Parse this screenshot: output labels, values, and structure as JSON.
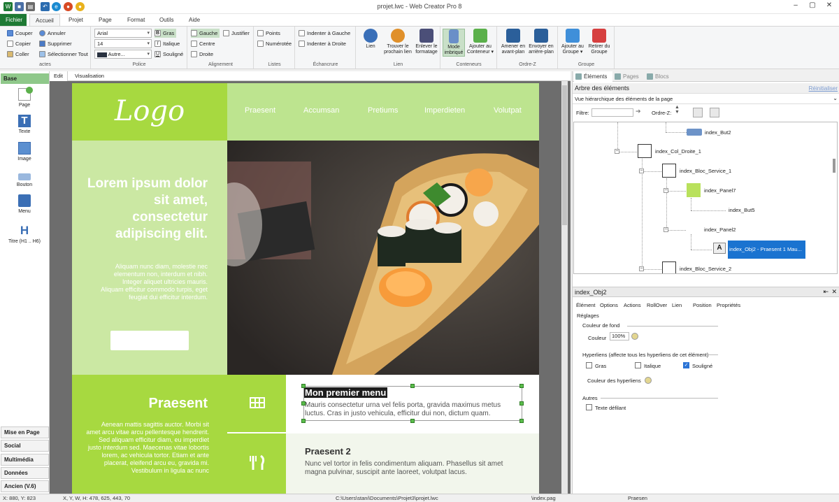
{
  "window": {
    "title": "projet.lwc - Web Creator Pro 8"
  },
  "ribbon_tabs": [
    "Fichier",
    "Accueil",
    "Projet",
    "Page",
    "Format",
    "Outils",
    "Aide"
  ],
  "ribbon": {
    "actes": {
      "label": "actes",
      "couper": "Couper",
      "copier": "Copier",
      "coller": "Coller",
      "annuler": "Annuler",
      "supprimer": "Supprimer",
      "selectionner": "Sélectionner Tout"
    },
    "police": {
      "label": "Police",
      "font": "Arial",
      "size": "14",
      "color": "Autre...",
      "gras": "Gras",
      "italique": "Italique",
      "souligne": "Souligné"
    },
    "alignement": {
      "label": "Alignement",
      "gauche": "Gauche",
      "centre": "Centre",
      "droite": "Droite",
      "justifier": "Justifier"
    },
    "listes": {
      "label": "Listes",
      "points": "Points",
      "numerotee": "Numérotée"
    },
    "echancrure": {
      "label": "Échancrure",
      "gauche": "Indenter à Gauche",
      "droite": "Indenter à Droite"
    },
    "lien": {
      "label": "Lien",
      "lien": "Lien",
      "trouver_l1": "Trouver le",
      "trouver_l2": "prochain lien",
      "enlever_l1": "Enlever le",
      "enlever_l2": "formatage"
    },
    "conteneurs": {
      "label": "Conteneurs",
      "mode_l1": "Mode",
      "mode_l2": "imbriqué",
      "ajouter_l1": "Ajouter au",
      "ajouter_l2": "Conteneur ▾"
    },
    "ordre": {
      "label": "Ordre-Z",
      "amener_l1": "Amener en",
      "amener_l2": "avant-plan",
      "envoyer_l1": "Envoyer en",
      "envoyer_l2": "arrière-plan"
    },
    "groupe": {
      "label": "Groupe",
      "ajouter_l1": "Ajouter au",
      "ajouter_l2": "Groupe ▾",
      "retirer_l1": "Retirer du",
      "retirer_l2": "Groupe"
    }
  },
  "left_panel": {
    "header": "Base",
    "tools": [
      "Page",
      "Texte",
      "Image",
      "Bouton",
      "Menu",
      "Titre (H1 .. H6)"
    ],
    "bottom": [
      "Mise en Page",
      "Social",
      "Multimédia",
      "Données",
      "Ancien (V.6)"
    ]
  },
  "doc_tabs": [
    "Edit",
    "Visualisation"
  ],
  "site": {
    "logo": "Logo",
    "nav": [
      "Praesent",
      "Accumsan",
      "Pretiums",
      "Imperdieten",
      "Volutpat"
    ],
    "hero_title": "Lorem ipsum dolor sit amet, consectetur adipiscing elit.",
    "hero_text": "Aliquam nunc diam, molestie nec elementum non, interdum et nibh. Integer aliquet ultricies mauris. Aliquam efficitur commodo turpis, eget feugiat dui efficitur interdum.",
    "praesent_title": "Praesent",
    "praesent_text": "Aenean mattis sagittis auctor. Morbi sit amet arcu vitae arcu pellentesque hendrerit. Sed aliquam efficitur diam, eu imperdiet justo interdum sed. Maecenas vitae lobortis lorem, ac vehicula tortor. Etiam et ante placerat, eleifend arcu eu, gravida mi. Vestibulum in ligula ac nunc",
    "services": [
      {
        "title": "Mon premier menu",
        "text": "Mauris consectetur urna vel felis porta, gravida maximus metus luctus. Cras in justo vehicula, efficitur dui non, dictum quam."
      },
      {
        "title": "Praesent 2",
        "text": "Nunc vel tortor in felis condimentum aliquam. Phasellus sit amet magna pulvinar, suscipit ante laoreet, volutpat lacus."
      }
    ]
  },
  "right_panel": {
    "tabs": [
      "Éléments",
      "Pages",
      "Blocs"
    ],
    "tree_title": "Arbre des éléments",
    "reset": "Réinitialiser",
    "view_select": "Vue hiérarchique des éléments de la page",
    "filter_label": "Filtre:",
    "order_label": "Ordre-Z:",
    "tree": [
      "index_But2",
      "index_Col_Droite_1",
      "index_Bloc_Service_1",
      "index_Panel7",
      "index_But5",
      "index_Panel2",
      "index_Obj2 - Praesent 1 Mau...",
      "index_Bloc_Service_2"
    ],
    "props_title": "index_Obj2",
    "props_tabs": [
      "Élément",
      "Options",
      "Actions",
      "RollOver",
      "Lien",
      "Position",
      "Propriétés"
    ],
    "reglages": "Réglages",
    "couleur_fond": "Couleur de fond",
    "couleur": "Couleur",
    "couleur_value": "100%",
    "hyperliens": "Hyperliens (affecte tous les hyperliens de cet élément)",
    "gras": "Gras",
    "italique": "Italique",
    "souligne": "Souligné",
    "couleur_hyperliens": "Couleur des hyperliens",
    "autres": "Autres",
    "texte_defilant": "Texte défilant"
  },
  "status": {
    "coords": "X: 880, Y: 823",
    "xywh": "X, Y, W, H: 478, 625, 443, 70",
    "path": "C:\\Users\\stani\\Documents\\Projet3\\projet.lwc",
    "page": "\\index.pag",
    "element": "Praesen"
  },
  "colors": {
    "accent_green": "#a7d940",
    "light_green": "#cbe8a3",
    "selection_blue": "#1a73d0",
    "file_tab": "#1e7a34"
  }
}
